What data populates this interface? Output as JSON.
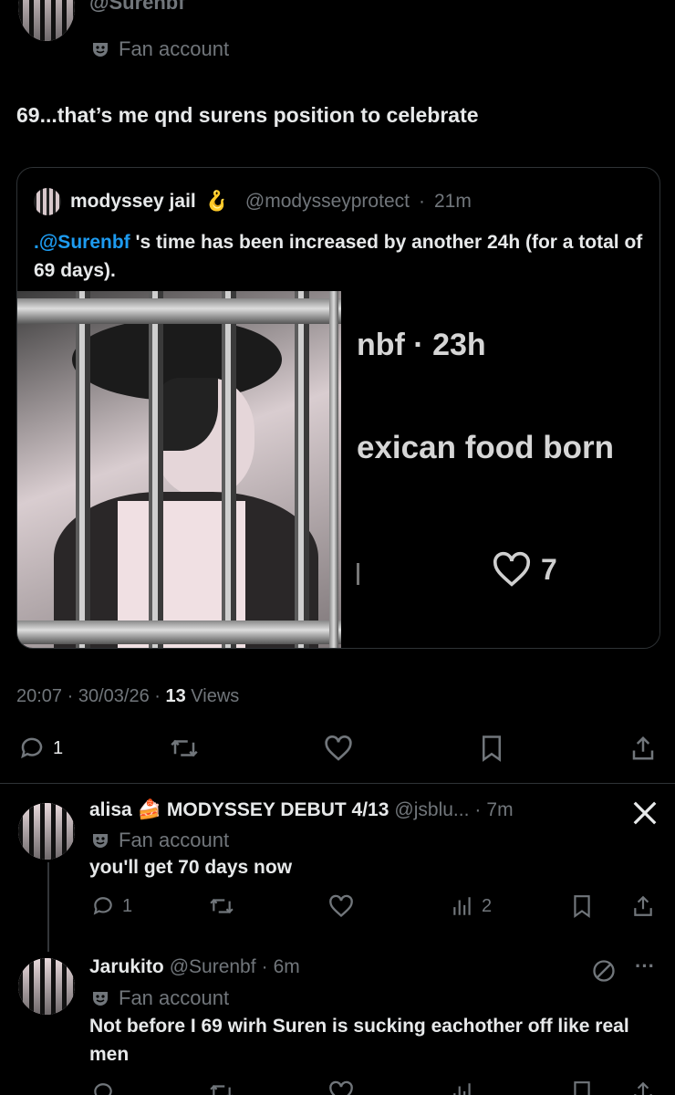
{
  "main_tweet": {
    "handle_partial": "@Surenbf",
    "badge": "Fan account",
    "text": "69...that’s me qnd surens position to celebrate",
    "quote": {
      "name": "modyssey jail",
      "emoji": "🪝",
      "handle": "@modysseyprotect",
      "time": "21m",
      "mention": ".@Surenbf",
      "text": " 's time has been increased by another 24h (for a total of 69 days).",
      "image_snippet": {
        "line1": "nbf · 23h",
        "line2": "exican food born",
        "likes": "7"
      }
    },
    "meta": {
      "time": "20:07",
      "date": "30/03/26",
      "views": "13",
      "views_label": "Views"
    },
    "actions": {
      "replies": "1",
      "retweets": "",
      "likes": "",
      "bookmark": "",
      "share": ""
    }
  },
  "replies": [
    {
      "name": "alisa",
      "emoji": "🍰",
      "name_suffix": "MODYSSEY DEBUT 4/13",
      "handle": "@jsblu...",
      "time": "7m",
      "badge": "Fan account",
      "text": "you'll get 70 days now",
      "actions": {
        "replies": "1",
        "views": "2"
      },
      "source_icon": "x-logo-icon"
    },
    {
      "name": "Jarukito",
      "handle": "@Surenbf",
      "time": "6m",
      "badge": "Fan account",
      "text": "Not before I 69 wirh Suren is sucking eachother off like real men",
      "source_icon": "no-sign-icon",
      "more": "···"
    }
  ],
  "colors": {
    "background": "#000000",
    "text": "#e7e9ea",
    "muted": "#71767b",
    "link": "#1d9bf0",
    "border": "#2f3336"
  }
}
